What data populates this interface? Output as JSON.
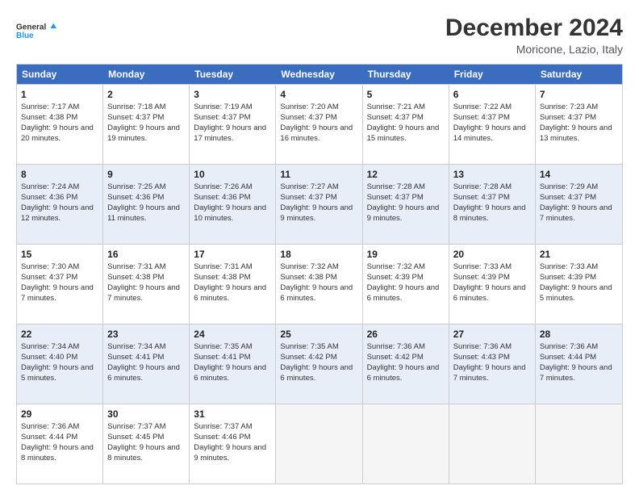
{
  "logo": {
    "line1": "General",
    "line2": "Blue"
  },
  "title": "December 2024",
  "location": "Moricone, Lazio, Italy",
  "days_of_week": [
    "Sunday",
    "Monday",
    "Tuesday",
    "Wednesday",
    "Thursday",
    "Friday",
    "Saturday"
  ],
  "weeks": [
    [
      {
        "day": 1,
        "sunrise": "7:17 AM",
        "sunset": "4:38 PM",
        "daylight": "9 hours and 20 minutes."
      },
      {
        "day": 2,
        "sunrise": "7:18 AM",
        "sunset": "4:37 PM",
        "daylight": "9 hours and 19 minutes."
      },
      {
        "day": 3,
        "sunrise": "7:19 AM",
        "sunset": "4:37 PM",
        "daylight": "9 hours and 17 minutes."
      },
      {
        "day": 4,
        "sunrise": "7:20 AM",
        "sunset": "4:37 PM",
        "daylight": "9 hours and 16 minutes."
      },
      {
        "day": 5,
        "sunrise": "7:21 AM",
        "sunset": "4:37 PM",
        "daylight": "9 hours and 15 minutes."
      },
      {
        "day": 6,
        "sunrise": "7:22 AM",
        "sunset": "4:37 PM",
        "daylight": "9 hours and 14 minutes."
      },
      {
        "day": 7,
        "sunrise": "7:23 AM",
        "sunset": "4:37 PM",
        "daylight": "9 hours and 13 minutes."
      }
    ],
    [
      {
        "day": 8,
        "sunrise": "7:24 AM",
        "sunset": "4:36 PM",
        "daylight": "9 hours and 12 minutes."
      },
      {
        "day": 9,
        "sunrise": "7:25 AM",
        "sunset": "4:36 PM",
        "daylight": "9 hours and 11 minutes."
      },
      {
        "day": 10,
        "sunrise": "7:26 AM",
        "sunset": "4:36 PM",
        "daylight": "9 hours and 10 minutes."
      },
      {
        "day": 11,
        "sunrise": "7:27 AM",
        "sunset": "4:37 PM",
        "daylight": "9 hours and 9 minutes."
      },
      {
        "day": 12,
        "sunrise": "7:28 AM",
        "sunset": "4:37 PM",
        "daylight": "9 hours and 9 minutes."
      },
      {
        "day": 13,
        "sunrise": "7:28 AM",
        "sunset": "4:37 PM",
        "daylight": "9 hours and 8 minutes."
      },
      {
        "day": 14,
        "sunrise": "7:29 AM",
        "sunset": "4:37 PM",
        "daylight": "9 hours and 7 minutes."
      }
    ],
    [
      {
        "day": 15,
        "sunrise": "7:30 AM",
        "sunset": "4:37 PM",
        "daylight": "9 hours and 7 minutes."
      },
      {
        "day": 16,
        "sunrise": "7:31 AM",
        "sunset": "4:38 PM",
        "daylight": "9 hours and 7 minutes."
      },
      {
        "day": 17,
        "sunrise": "7:31 AM",
        "sunset": "4:38 PM",
        "daylight": "9 hours and 6 minutes."
      },
      {
        "day": 18,
        "sunrise": "7:32 AM",
        "sunset": "4:38 PM",
        "daylight": "9 hours and 6 minutes."
      },
      {
        "day": 19,
        "sunrise": "7:32 AM",
        "sunset": "4:39 PM",
        "daylight": "9 hours and 6 minutes."
      },
      {
        "day": 20,
        "sunrise": "7:33 AM",
        "sunset": "4:39 PM",
        "daylight": "9 hours and 6 minutes."
      },
      {
        "day": 21,
        "sunrise": "7:33 AM",
        "sunset": "4:39 PM",
        "daylight": "9 hours and 5 minutes."
      }
    ],
    [
      {
        "day": 22,
        "sunrise": "7:34 AM",
        "sunset": "4:40 PM",
        "daylight": "9 hours and 5 minutes."
      },
      {
        "day": 23,
        "sunrise": "7:34 AM",
        "sunset": "4:41 PM",
        "daylight": "9 hours and 6 minutes."
      },
      {
        "day": 24,
        "sunrise": "7:35 AM",
        "sunset": "4:41 PM",
        "daylight": "9 hours and 6 minutes."
      },
      {
        "day": 25,
        "sunrise": "7:35 AM",
        "sunset": "4:42 PM",
        "daylight": "9 hours and 6 minutes."
      },
      {
        "day": 26,
        "sunrise": "7:36 AM",
        "sunset": "4:42 PM",
        "daylight": "9 hours and 6 minutes."
      },
      {
        "day": 27,
        "sunrise": "7:36 AM",
        "sunset": "4:43 PM",
        "daylight": "9 hours and 7 minutes."
      },
      {
        "day": 28,
        "sunrise": "7:36 AM",
        "sunset": "4:44 PM",
        "daylight": "9 hours and 7 minutes."
      }
    ],
    [
      {
        "day": 29,
        "sunrise": "7:36 AM",
        "sunset": "4:44 PM",
        "daylight": "9 hours and 8 minutes."
      },
      {
        "day": 30,
        "sunrise": "7:37 AM",
        "sunset": "4:45 PM",
        "daylight": "9 hours and 8 minutes."
      },
      {
        "day": 31,
        "sunrise": "7:37 AM",
        "sunset": "4:46 PM",
        "daylight": "9 hours and 9 minutes."
      },
      null,
      null,
      null,
      null
    ]
  ],
  "labels": {
    "sunrise": "Sunrise:",
    "sunset": "Sunset:",
    "daylight": "Daylight:"
  }
}
